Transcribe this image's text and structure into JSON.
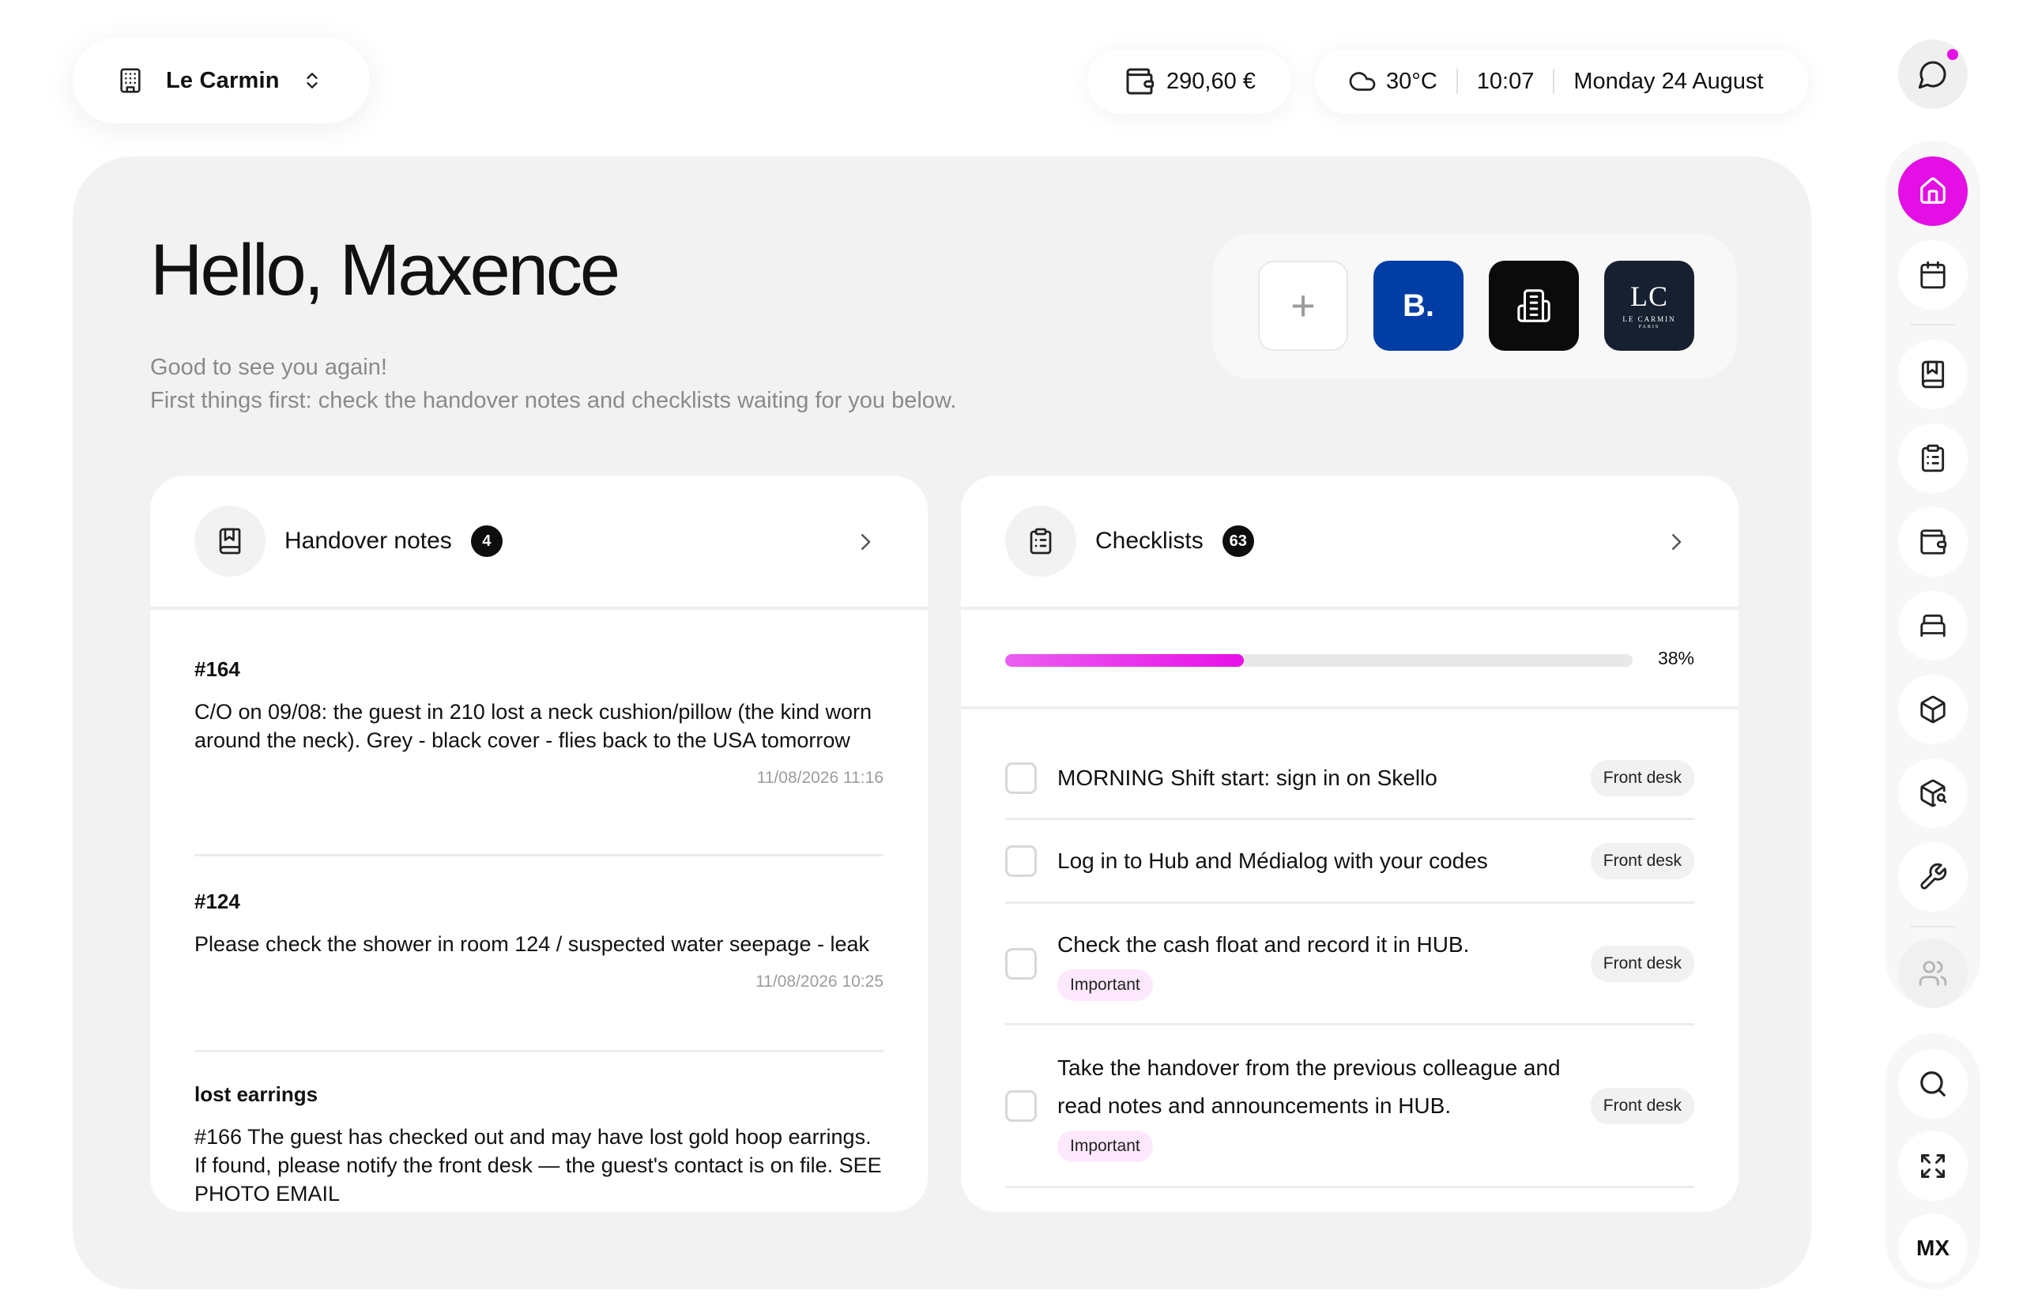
{
  "topbar": {
    "hotel_name": "Le Carmin",
    "balance": "290,60 €",
    "temperature": "30°C",
    "time": "10:07",
    "date": "Monday 24 August"
  },
  "greeting": {
    "title": "Hello, Maxence",
    "line1": "Good to see you again!",
    "line2": "First things first: check the handover notes and checklists waiting for you below."
  },
  "apps": {
    "add_label": "+",
    "booking_label": "B.",
    "lc_logo": "LC",
    "lc_sub": "LE CARMIN",
    "lc_sub2": "PARIS"
  },
  "handover": {
    "title": "Handover notes",
    "count": "4",
    "notes": [
      {
        "title": "#164",
        "body": "C/O on 09/08: the guest in 210 lost a neck cushion/pillow (the kind worn around the neck). Grey - black cover - flies back to the USA tomorrow",
        "time": "11/08/2026 11:16"
      },
      {
        "title": "#124",
        "body": "Please check the shower in room 124 / suspected water seepage - leak",
        "time": "11/08/2026 10:25"
      },
      {
        "title": "lost earrings",
        "body": "#166 The guest has checked out and may have lost gold hoop earrings. If found, please notify the front desk — the guest's contact is on file. SEE PHOTO EMAIL",
        "time": ""
      }
    ]
  },
  "checklists": {
    "title": "Checklists",
    "count": "63",
    "progress": 0.38,
    "progress_label": "38%",
    "items": [
      {
        "text": "MORNING Shift start: sign in on Skello",
        "important": "",
        "tag": "Front desk"
      },
      {
        "text": "Log in to Hub and Médialog with your codes",
        "important": "",
        "tag": "Front desk"
      },
      {
        "text": "Check the cash float and record it in HUB.",
        "important": "Important",
        "tag": "Front desk"
      },
      {
        "text": "Take the handover from the previous colleague and read notes and announcements in HUB.",
        "important": "Important",
        "tag": "Front desk"
      }
    ]
  },
  "sidebar": {
    "user_initials": "MX",
    "nav_icons": [
      "home-icon",
      "calendar-icon",
      "notebook-icon",
      "clipboard-icon",
      "wallet-icon",
      "bed-icon",
      "box-icon",
      "package-search-icon",
      "wrench-icon",
      "users-icon"
    ],
    "tool_icons": [
      "search-icon",
      "expand-icon"
    ]
  },
  "colors": {
    "accent": "#e30fe4",
    "booking_blue": "#003da5",
    "panel": "#f2f2f2"
  }
}
